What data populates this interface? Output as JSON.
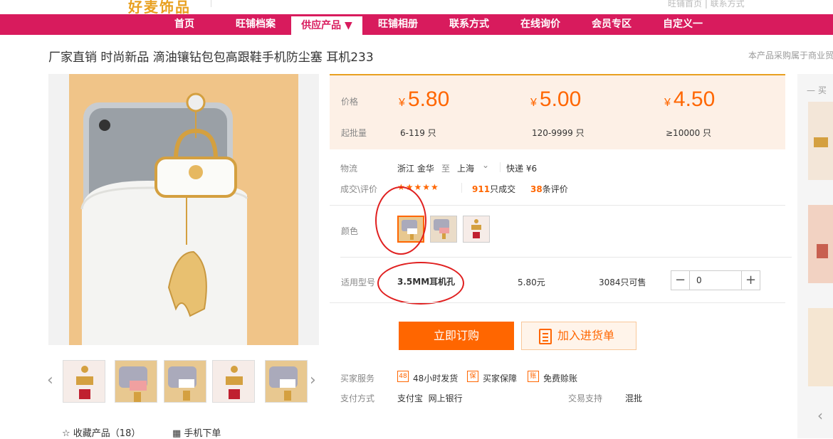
{
  "header": {
    "logo_text": "好麦饰品",
    "right_text": "旺铺首页 | 联系方式"
  },
  "nav": {
    "items": [
      {
        "label": "首页"
      },
      {
        "label": "旺铺档案"
      },
      {
        "label": "供应产品 ▼"
      },
      {
        "label": "旺铺相册"
      },
      {
        "label": "联系方式"
      },
      {
        "label": "在线询价"
      },
      {
        "label": "会员专区"
      },
      {
        "label": "自定义一"
      }
    ],
    "active_index": 2
  },
  "product": {
    "title": "厂家直销 时尚新品 滴油镶钻包包高跟鞋手机防尘塞 耳机233",
    "right_note": "本产品采购属于商业贸易行为"
  },
  "gallery": {
    "prev_icon": "chevron-left-icon",
    "next_icon": "chevron-right-icon",
    "collect_label": "收藏产品（18）",
    "mobile_order_label": "手机下单"
  },
  "pricing": {
    "price_label": "价格",
    "moq_label": "起批量",
    "currency_symbol": "¥",
    "tiers": [
      {
        "price": "5.80",
        "range": "6-119 只"
      },
      {
        "price": "5.00",
        "range": "120-9999 只"
      },
      {
        "price": "4.50",
        "range": "≥10000 只"
      }
    ]
  },
  "logistics": {
    "label": "物流",
    "from": "浙江 金华",
    "to_word": "至",
    "to": "上海",
    "express": "快递 ¥6"
  },
  "trade": {
    "label": "成交\\评价",
    "stars": "★★★★★",
    "deals_count": "911",
    "deals_suffix": "只成交",
    "reviews_count": "38",
    "reviews_suffix": "条评价"
  },
  "color": {
    "label": "颜色"
  },
  "model": {
    "label": "适用型号",
    "name": "3.5MM耳机孔",
    "price": "5.80元",
    "stock": "3084只可售",
    "quantity": "0"
  },
  "actions": {
    "buy_label": "立即订购",
    "cart_label": "加入进货单"
  },
  "services": {
    "label": "买家服务",
    "items": [
      {
        "icon_text": "48",
        "label": "48小时发货"
      },
      {
        "icon_text": "保",
        "label": "买家保障"
      },
      {
        "icon_text": "账",
        "label": "免费赊账"
      }
    ]
  },
  "payment": {
    "label": "支付方式",
    "methods": "支付宝  网上银行",
    "trade_support_label": "交易支持",
    "trade_support_value": "混批"
  },
  "right_panel": {
    "title": "买"
  },
  "colors": {
    "nav_bg": "#d81b5d",
    "accent": "#ff6600",
    "price_bg": "#fdf0e6"
  }
}
